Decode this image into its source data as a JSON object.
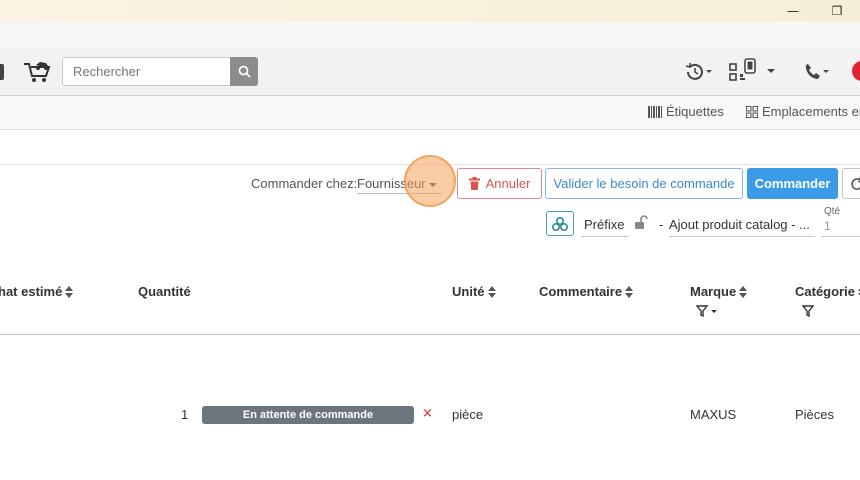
{
  "window": {
    "minimize_glyph": "—",
    "restore_glyph": "❐"
  },
  "toolbar": {
    "search": {
      "placeholder": "Rechercher",
      "value": ""
    },
    "icons": [
      "cart-icon",
      "search-icon",
      "history-icon",
      "qr-code-icon",
      "phone-icon"
    ]
  },
  "subbar": {
    "labels_link": "Étiquettes",
    "locations_link": "Emplacements en"
  },
  "order": {
    "order_from_label": "Commander chez:",
    "supplier_value": "Fournisseur",
    "cancel_label": "Annuler",
    "validate_label": "Valider le besoin de commande",
    "order_label": "Commander"
  },
  "product_entry": {
    "prefix_label": "Préfixe",
    "dash": "-",
    "catalog_value": "Ajout produit catalog - ...",
    "qty_label": "Qté",
    "qty_value": "1"
  },
  "table": {
    "columns": {
      "estimated": "hat estimé",
      "quantity": "Quantité",
      "unit": "Unité",
      "comment": "Commentaire",
      "brand": "Marque",
      "category": "Catégorie"
    },
    "rows": [
      {
        "quantity": "1",
        "status": "En attente de commande",
        "remove": "×",
        "unit": "pièce",
        "comment": "",
        "brand": "MAXUS",
        "category": "Pièces"
      }
    ]
  },
  "colors": {
    "primary": "#3a9be6",
    "danger": "#d9534f",
    "badge": "#6c757d",
    "highlight": "#f5a35a"
  }
}
